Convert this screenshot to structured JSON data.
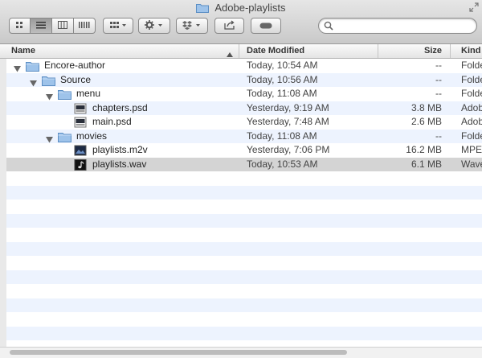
{
  "window": {
    "title": "Adobe-playlists"
  },
  "toolbar": {
    "view_buttons": [
      "icon-view-icon",
      "list-view-icon",
      "column-view-icon",
      "cover-flow-icon"
    ],
    "active_view": "list",
    "search_placeholder": ""
  },
  "columns": {
    "name": "Name",
    "date": "Date Modified",
    "size": "Size",
    "kind": "Kind"
  },
  "rows": [
    {
      "name": "Encore-author",
      "level": 0,
      "type": "folder",
      "expanded": true,
      "date": "Today, 10:54 AM",
      "size": "--",
      "kind": "Folde"
    },
    {
      "name": "Source",
      "level": 1,
      "type": "folder",
      "expanded": true,
      "date": "Today, 10:56 AM",
      "size": "--",
      "kind": "Folde"
    },
    {
      "name": "menu",
      "level": 2,
      "type": "folder",
      "expanded": true,
      "date": "Today, 11:08 AM",
      "size": "--",
      "kind": "Folde"
    },
    {
      "name": "chapters.psd",
      "level": 3,
      "type": "psd",
      "date": "Yesterday, 9:19 AM",
      "size": "3.8 MB",
      "kind": "Adob"
    },
    {
      "name": "main.psd",
      "level": 3,
      "type": "psd",
      "date": "Yesterday, 7:48 AM",
      "size": "2.6 MB",
      "kind": "Adob"
    },
    {
      "name": "movies",
      "level": 2,
      "type": "folder",
      "expanded": true,
      "date": "Today, 11:08 AM",
      "size": "--",
      "kind": "Folde"
    },
    {
      "name": "playlists.m2v",
      "level": 3,
      "type": "video",
      "date": "Yesterday, 7:06 PM",
      "size": "16.2 MB",
      "kind": "MPEG"
    },
    {
      "name": "playlists.wav",
      "level": 3,
      "type": "audio",
      "date": "Today, 10:53 AM",
      "size": "6.1 MB",
      "kind": "Wave",
      "selected": true
    }
  ],
  "colors": {
    "row_alt": "#edf3fe",
    "selected_row": "#d4d4d4",
    "folder": "#8fbbe8"
  }
}
